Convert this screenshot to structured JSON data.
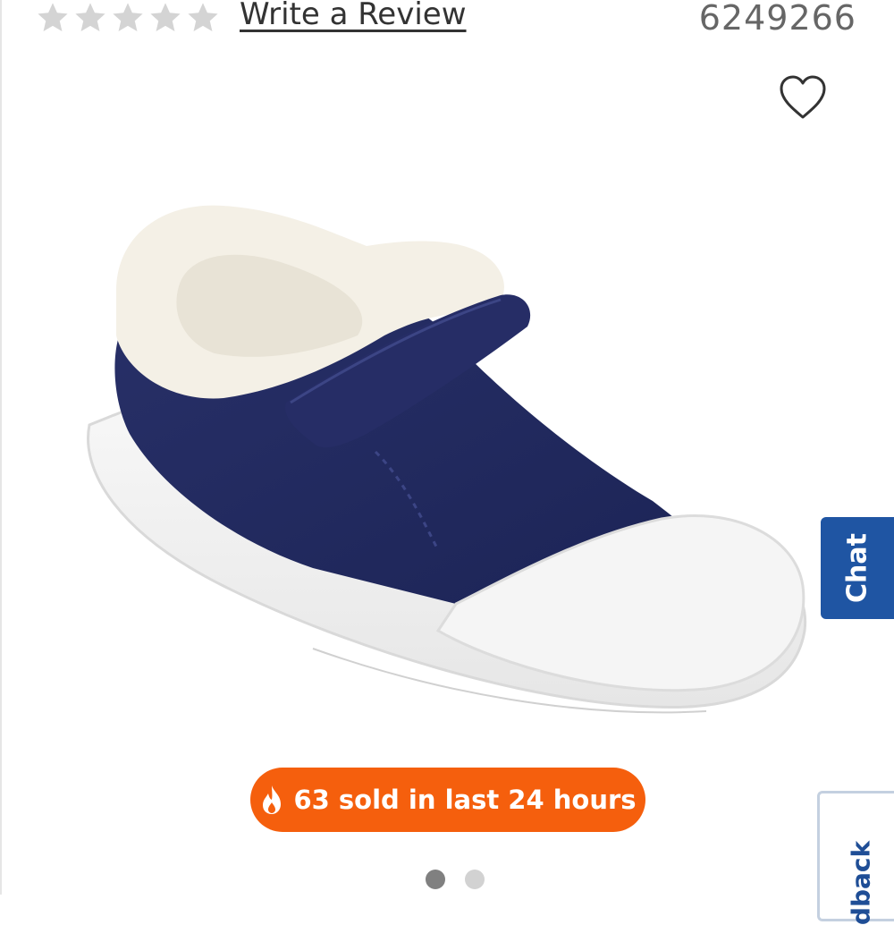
{
  "rating": {
    "stars": 0,
    "max_stars": 5,
    "empty_star_color": "#d4d4d4",
    "write_review_label": "Write a Review"
  },
  "product": {
    "id": "6249266",
    "image_alt": "navy shoe with fur lining"
  },
  "favorite": {
    "icon": "heart-outline-icon"
  },
  "side_tabs": {
    "chat_label": "Chat",
    "feedback_label": "dback"
  },
  "badge": {
    "icon": "flame-icon",
    "text": "63 sold in last 24 hours",
    "color": "#f55f0d"
  },
  "carousel": {
    "total": 2,
    "active": 1
  }
}
